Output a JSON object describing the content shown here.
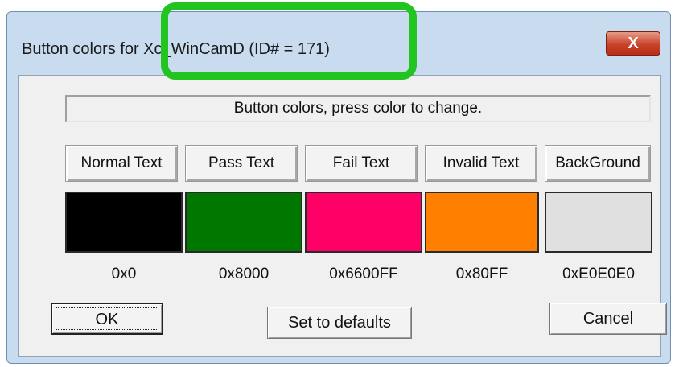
{
  "window": {
    "title": "Button colors for  Xc_WinCamD (ID# = 171)",
    "close_glyph": "X"
  },
  "info_text": "Button colors, press color to change.",
  "colors": [
    {
      "label": "Normal Text",
      "hex_text": "0x0",
      "swatch": "#000000"
    },
    {
      "label": "Pass Text",
      "hex_text": "0x8000",
      "swatch": "#007800"
    },
    {
      "label": "Fail Text",
      "hex_text": "0x6600FF",
      "swatch": "#ff0066"
    },
    {
      "label": "Invalid Text",
      "hex_text": "0x80FF",
      "swatch": "#ff8000"
    },
    {
      "label": "BackGround",
      "hex_text": "0xE0E0E0",
      "swatch": "#e0e0e0"
    }
  ],
  "buttons": {
    "ok": "OK",
    "defaults": "Set to defaults",
    "cancel": "Cancel"
  },
  "accent": {
    "highlight_box": "#22c41f"
  }
}
